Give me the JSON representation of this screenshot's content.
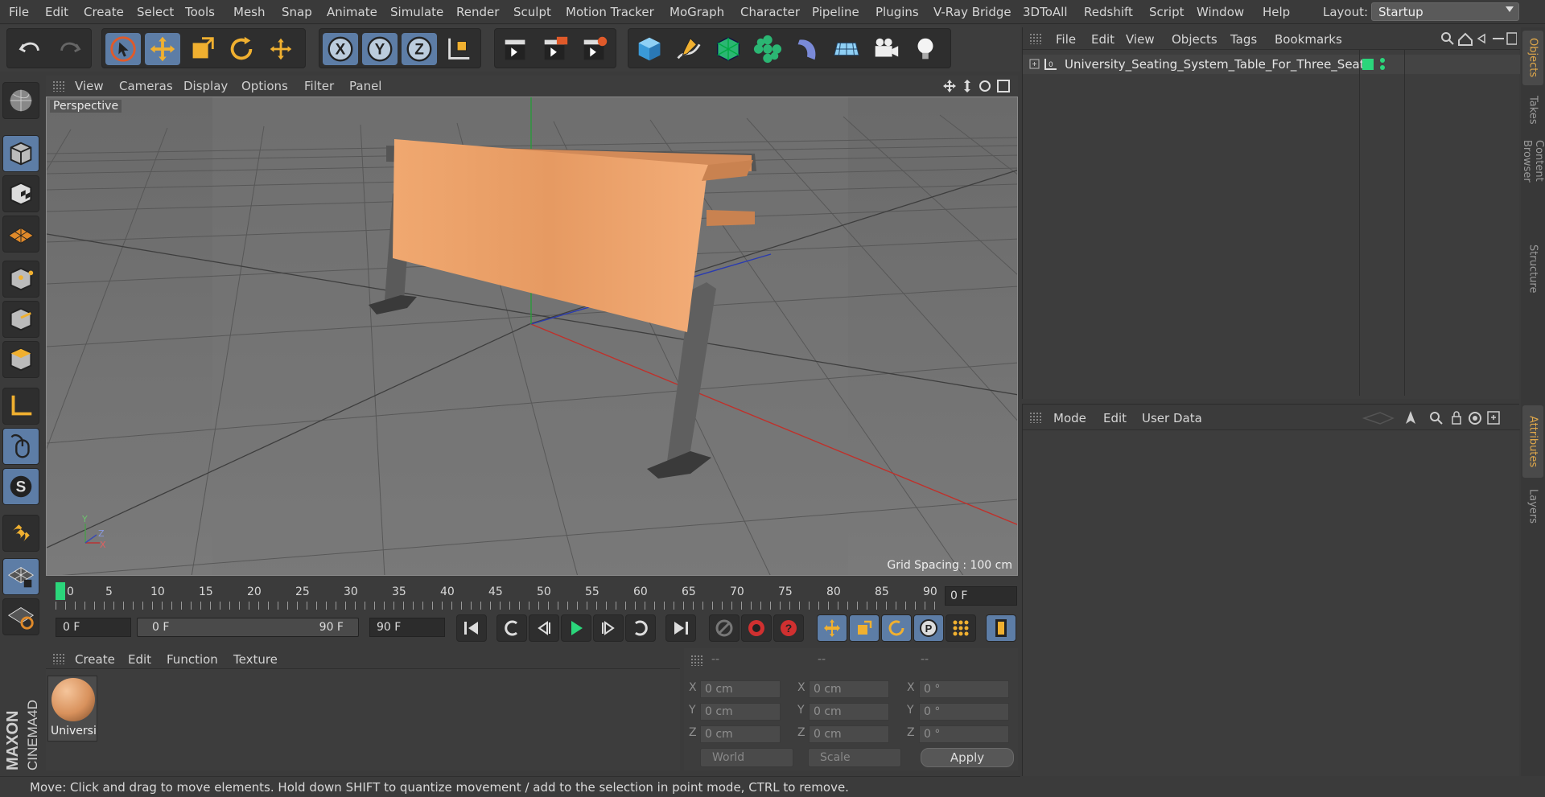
{
  "menubar": {
    "items": [
      "File",
      "Edit",
      "Create",
      "Select",
      "Tools",
      "Mesh",
      "Snap",
      "Animate",
      "Simulate",
      "Render",
      "Sculpt",
      "Motion Tracker",
      "MoGraph",
      "Character",
      "Pipeline",
      "Plugins",
      "V-Ray Bridge",
      "3DToAll",
      "Redshift",
      "Script",
      "Window",
      "Help"
    ],
    "layout_label": "Layout:",
    "layout_value": "Startup"
  },
  "toolbar": {
    "icons": [
      "undo-icon",
      "redo-icon",
      "live-selection-icon",
      "move-icon",
      "scale-icon",
      "rotate-icon",
      "move-recent-icon",
      "x-axis-icon",
      "y-axis-icon",
      "z-axis-icon",
      "coordinate-system-icon",
      "render-view-icon",
      "render-picture-viewer-icon",
      "render-settings-icon",
      "cube-icon",
      "pen-spline-icon",
      "subdivision-surface-icon",
      "cloner-icon",
      "deformer-icon",
      "floor-icon",
      "camera-icon",
      "light-icon"
    ],
    "axis_letters": [
      "X",
      "Y",
      "Z"
    ]
  },
  "viewport": {
    "menu": [
      "View",
      "Cameras",
      "Display",
      "Options",
      "Filter",
      "Panel"
    ],
    "perspective_label": "Perspective",
    "grid_spacing": "Grid Spacing : 100 cm",
    "axis_labels": {
      "y": "Y",
      "z": "Z",
      "x": "X"
    }
  },
  "timeline": {
    "ticks": [
      "0",
      "5",
      "10",
      "15",
      "20",
      "25",
      "30",
      "35",
      "40",
      "45",
      "50",
      "55",
      "60",
      "65",
      "70",
      "75",
      "80",
      "85",
      "90"
    ],
    "current_frame": "0 F"
  },
  "transport": {
    "start_field": "0 F",
    "range_start": "0 F",
    "range_end": "90 F",
    "end_field": "90 F"
  },
  "material_manager": {
    "menu": [
      "Create",
      "Edit",
      "Function",
      "Texture"
    ],
    "material_name": "Universi"
  },
  "coordinates": {
    "headers": [
      "--",
      "--",
      "--"
    ],
    "rows": [
      {
        "axis": "X",
        "pos": "0 cm",
        "size": "0 cm",
        "rot": "0 °"
      },
      {
        "axis": "Y",
        "pos": "0 cm",
        "size": "0 cm",
        "rot": "0 °"
      },
      {
        "axis": "Z",
        "pos": "0 cm",
        "size": "0 cm",
        "rot": "0 °"
      }
    ],
    "world_dropdown": "World",
    "scale_dropdown": "Scale",
    "apply_label": "Apply"
  },
  "status": {
    "text": "Move: Click and drag to move elements. Hold down SHIFT to quantize movement / add to the selection in point mode, CTRL to remove."
  },
  "object_manager": {
    "menu": [
      "File",
      "Edit",
      "View",
      "Objects",
      "Tags",
      "Bookmarks"
    ],
    "object_name": "University_Seating_System_Table_For_Three_Seats",
    "object_layer_badge": "L0"
  },
  "attribute_manager": {
    "menu": [
      "Mode",
      "Edit",
      "User Data"
    ]
  },
  "right_tabs": [
    "Objects",
    "Takes",
    "Content Browser",
    "Structure",
    "Attributes",
    "Layers"
  ],
  "logo": {
    "brand": "MAXON",
    "product": "CINEMA4D"
  },
  "colors": {
    "accent_blue": "#5d7da6",
    "ui_bg": "#3b3b3b",
    "viewport_bg": "#6d6d6d",
    "table_wood": "#e59a66",
    "active_tab": "#e0a84a",
    "status_green": "#2ecc71"
  }
}
